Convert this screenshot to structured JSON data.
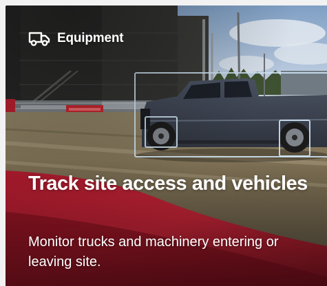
{
  "card": {
    "category": {
      "icon": "truck-icon",
      "label": "Equipment"
    },
    "title": "Track site access and vehicles",
    "description": "Monitor trucks and machinery entering or leaving site."
  },
  "colors": {
    "text": "#ffffff",
    "detection_box": "#cfe3f2",
    "accent_red": "#c8102e"
  }
}
